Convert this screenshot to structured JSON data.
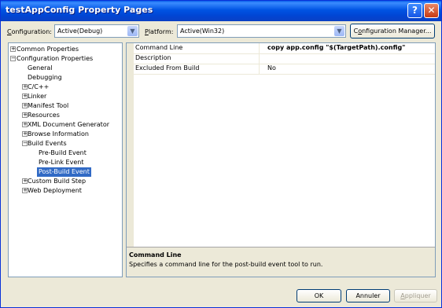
{
  "window": {
    "title": "testAppConfig Property Pages"
  },
  "titlebar": {
    "help": "?",
    "close": "✕"
  },
  "toolbar": {
    "configuration_label": "Configuration:",
    "configuration_value": "Active(Debug)",
    "platform_label": "Platform:",
    "platform_value": "Active(Win32)",
    "config_manager_label": "Configuration Manager..."
  },
  "tree": {
    "items": [
      {
        "label": "Common Properties",
        "expander": "+"
      },
      {
        "label": "Configuration Properties",
        "expander": "−"
      },
      {
        "label": "General"
      },
      {
        "label": "Debugging"
      },
      {
        "label": "C/C++",
        "expander": "+"
      },
      {
        "label": "Linker",
        "expander": "+"
      },
      {
        "label": "Manifest Tool",
        "expander": "+"
      },
      {
        "label": "Resources",
        "expander": "+"
      },
      {
        "label": "XML Document Generator",
        "expander": "+"
      },
      {
        "label": "Browse Information",
        "expander": "+"
      },
      {
        "label": "Build Events",
        "expander": "−"
      },
      {
        "label": "Pre-Build Event"
      },
      {
        "label": "Pre-Link Event"
      },
      {
        "label": "Post-Build Event",
        "selected": true
      },
      {
        "label": "Custom Build Step",
        "expander": "+"
      },
      {
        "label": "Web Deployment",
        "expander": "+"
      }
    ]
  },
  "grid": {
    "rows": [
      {
        "name": "Command Line",
        "value": "copy app.config \"$(TargetPath).config\""
      },
      {
        "name": "Description",
        "value": ""
      },
      {
        "name": "Excluded From Build",
        "value": "No"
      }
    ]
  },
  "description": {
    "title": "Command Line",
    "text": "Specifies a command line for the post-build event tool to run."
  },
  "buttons": {
    "ok": "OK",
    "cancel": "Annuler",
    "apply": "Appliquer"
  }
}
